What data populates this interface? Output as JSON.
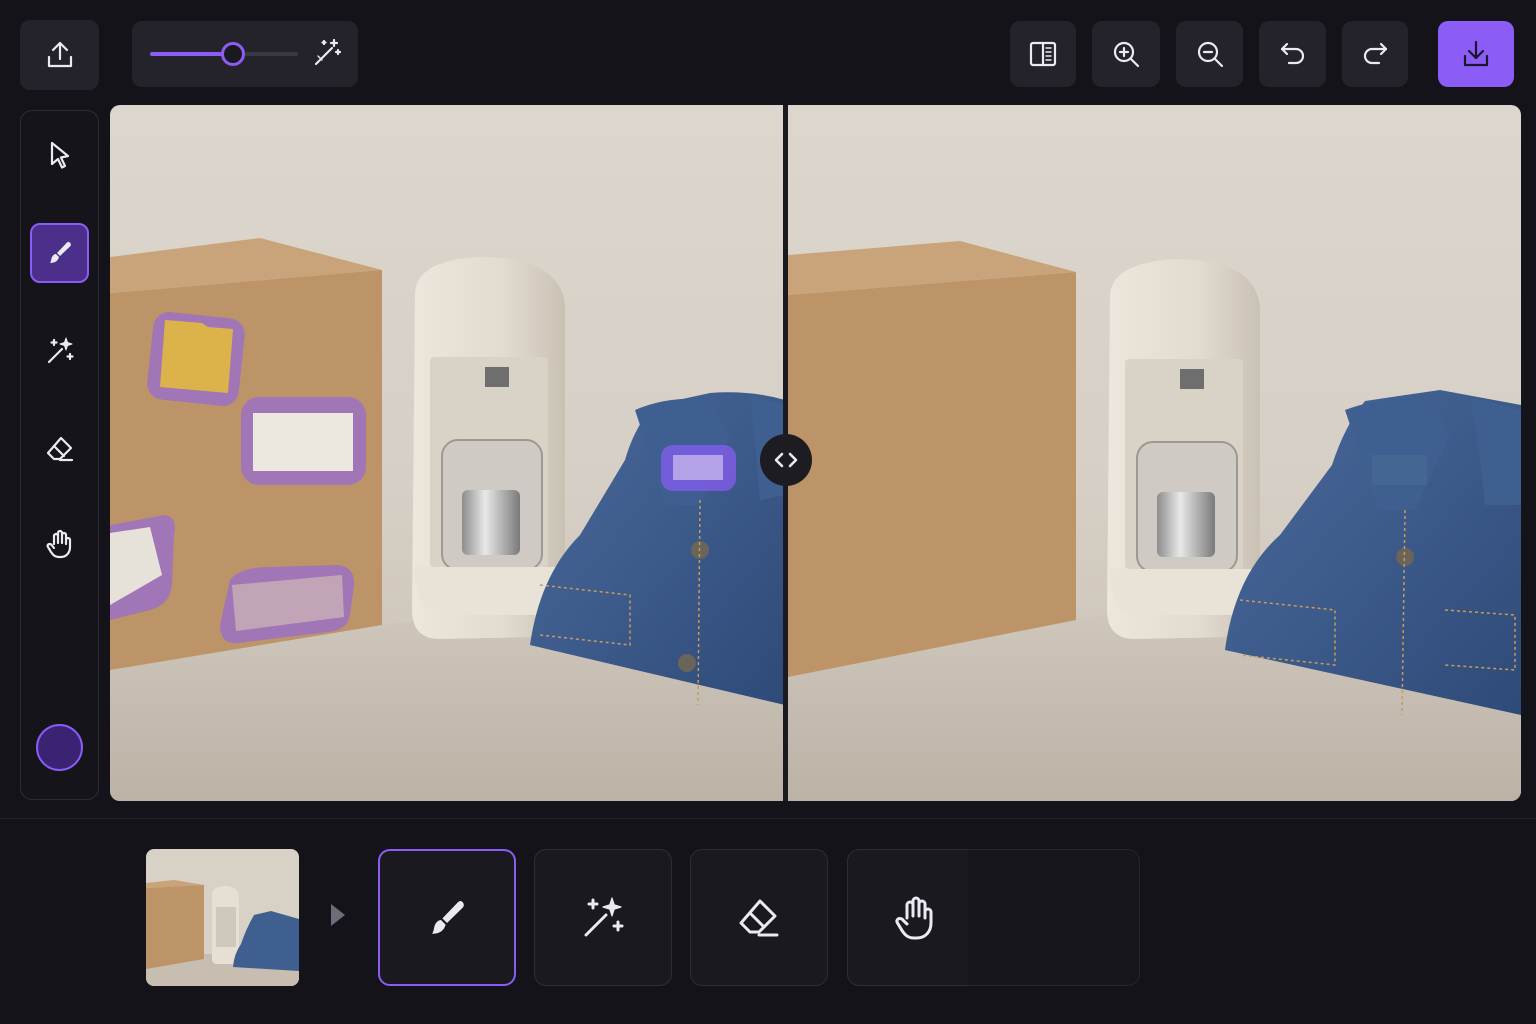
{
  "toolbar": {
    "upload_icon": "upload-icon",
    "brush_size": {
      "value": 0.56,
      "icon": "magic-wand-icon"
    },
    "actions": [
      {
        "name": "compare-toggle",
        "icon": "split-view-icon"
      },
      {
        "name": "zoom-in",
        "icon": "zoom-in-icon"
      },
      {
        "name": "zoom-out",
        "icon": "zoom-out-icon"
      },
      {
        "name": "undo",
        "icon": "undo-icon"
      },
      {
        "name": "redo",
        "icon": "redo-icon"
      },
      {
        "name": "download",
        "icon": "download-icon"
      }
    ]
  },
  "tool_rail": {
    "tools": [
      {
        "name": "select",
        "icon": "cursor-icon",
        "active": false
      },
      {
        "name": "brush",
        "icon": "brush-icon",
        "active": true
      },
      {
        "name": "magic",
        "icon": "sparkles-wand-icon",
        "active": false
      },
      {
        "name": "eraser",
        "icon": "eraser-icon",
        "active": false
      },
      {
        "name": "pan",
        "icon": "hand-icon",
        "active": false
      }
    ],
    "brush_color": "#3b2374"
  },
  "canvas": {
    "mode": "before-after-split",
    "mask_color": "#8b5cf6",
    "comparison_handle_icon": "code-arrows-icon"
  },
  "bottom_bar": {
    "thumbnail": "scene-thumbnail",
    "tools": [
      {
        "name": "brush",
        "icon": "brush-icon",
        "active": true
      },
      {
        "name": "magic",
        "icon": "sparkles-wand-icon",
        "active": false
      },
      {
        "name": "eraser",
        "icon": "eraser-icon",
        "active": false
      },
      {
        "name": "pan",
        "icon": "hand-icon",
        "active": false
      }
    ]
  },
  "colors": {
    "accent": "#8b5cf6",
    "background": "#141319",
    "panel": "#24232b"
  }
}
